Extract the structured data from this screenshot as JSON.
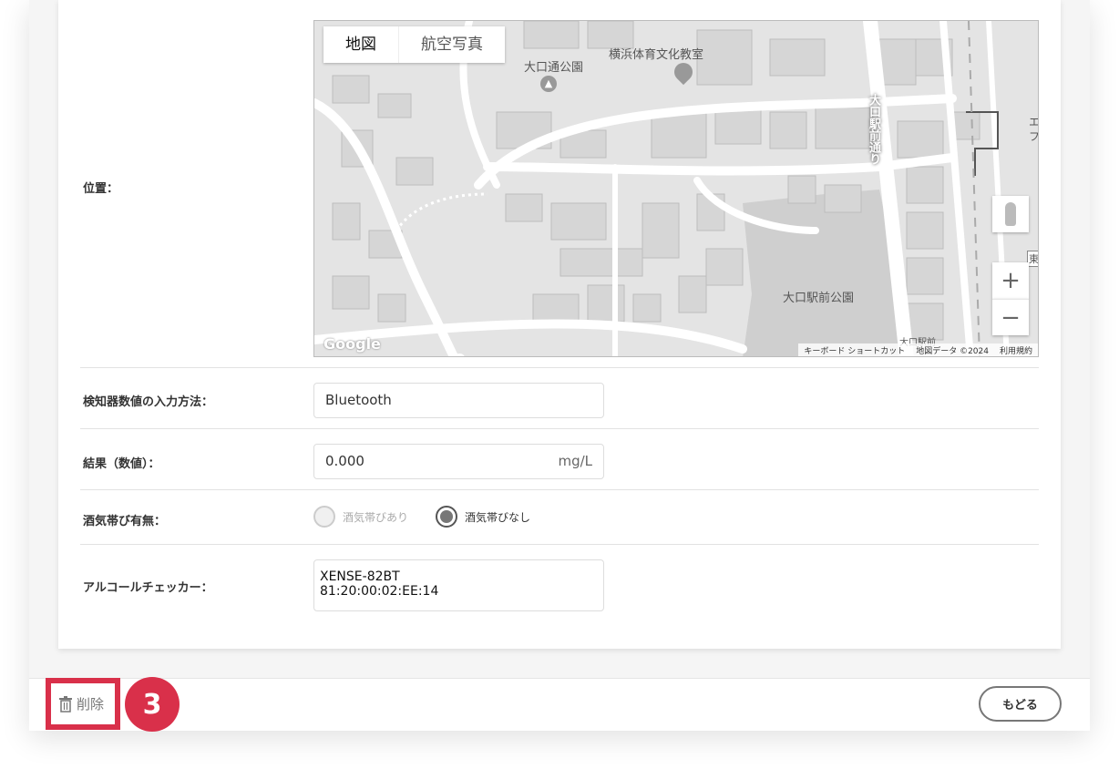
{
  "form": {
    "location_label": "位置：",
    "input_method_label": "検知器数値の入力方法：",
    "input_method_value": "Bluetooth",
    "result_label": "結果（数値）：",
    "result_value": "0.000",
    "result_unit": "mg/L",
    "alcohol_label": "酒気帯び有無：",
    "alcohol_options": [
      {
        "label": "酒気帯びあり",
        "checked": false,
        "disabled": true
      },
      {
        "label": "酒気帯びなし",
        "checked": true,
        "disabled": false
      }
    ],
    "checker_label": "アルコールチェッカー：",
    "checker_value": "XENSE-82BT\n81:20:00:02:EE:14"
  },
  "map": {
    "tabs": [
      "地図",
      "航空写真"
    ],
    "places": {
      "park1": "大口通公園",
      "gym": "横浜体育文化教室",
      "park2": "大口駅前公園",
      "station": "大口駅前",
      "road": "大口駅前通り"
    },
    "edge_chars": [
      "エ",
      "フ",
      "東"
    ],
    "zoom_in": "+",
    "zoom_out": "−",
    "logo": "Google",
    "attribution": [
      "キーボード ショートカット",
      "地図データ ©2024",
      "利用規約"
    ]
  },
  "footer": {
    "delete_label": "削除",
    "step_number": "3",
    "back_label": "もどる"
  },
  "colors": {
    "accent_red": "#d9304a"
  },
  "icons": {
    "delete": "trash-icon",
    "street_view": "pegman-icon",
    "park": "tree-pin-icon",
    "place": "location-pin-icon"
  }
}
